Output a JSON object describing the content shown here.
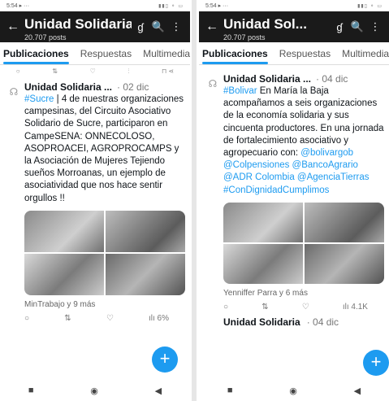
{
  "left": {
    "status": {
      "time": "5:54 ▸ ···",
      "icons": "▮▮▯ ⚬ ▭"
    },
    "appbar": {
      "back": "←",
      "title": "Unidad Solidaria",
      "subtitle": "20.707 posts",
      "action_icon": "ɠ",
      "search": "🔍",
      "more": "⋮"
    },
    "tabs": [
      "Publicaciones",
      "Respuestas",
      "Multimedia"
    ],
    "prev_actions": [
      "○",
      "⇅",
      "♡",
      "⫶",
      "⊓ ⋖"
    ],
    "tweet": {
      "pin": "☊",
      "name": "Unidad Solidaria ...",
      "date": "· 02 dic",
      "hashtag": "#Sucre",
      "text": " | 4 de nuestras organizaciones campesinas, del Circuito Asociativo Solidario de Sucre, participaron en CampeSENA: ONNECOLOSO, ASOPROACEI, AGROPROCAMPS y la Asociación de Mujeres Tejiendo sueños Morroanas, un ejemplo de asociatividad que nos hace sentir orgullos !!",
      "tagged": "MinTrabajo y 9 más",
      "actions": [
        "○",
        "⇅",
        "♡",
        "ılı 6%"
      ]
    },
    "fab": "+",
    "nav": [
      "■",
      "◉",
      "◀"
    ]
  },
  "right": {
    "status": {
      "time": "5:54 ▸ ···",
      "icons": "▮▮▯ ⚬ ▭"
    },
    "appbar": {
      "back": "←",
      "title": "Unidad Sol...",
      "subtitle": "20.707 posts",
      "action_icon": "ɠ",
      "search": "🔍",
      "more": "⋮"
    },
    "tabs": [
      "Publicaciones",
      "Respuestas",
      "Multimedia"
    ],
    "tweet": {
      "pin": "☊",
      "name": "Unidad Solidaria ...",
      "date": "· 04 dic",
      "hashtag": "#Bolivar",
      "text": " En María la Baja acompañamos a seis organizaciones de la economía solidaria y sus cincuenta productores. En una jornada de fortalecimiento asociativo y agropecuario con: ",
      "mentions": "@bolivargob @Colpensiones @BancoAgrario @ADR Colombia @AgenciaTierras #ConDignidadCumplimos",
      "tagged": "Yenniffer Parra y 6 más",
      "actions": [
        "○",
        "⇅",
        "♡",
        "ılı 4.1K"
      ]
    },
    "next": {
      "name": "Unidad Solidaria",
      "date": "· 04 dic"
    },
    "fab": "+",
    "nav": [
      "■",
      "◉",
      "◀"
    ]
  }
}
